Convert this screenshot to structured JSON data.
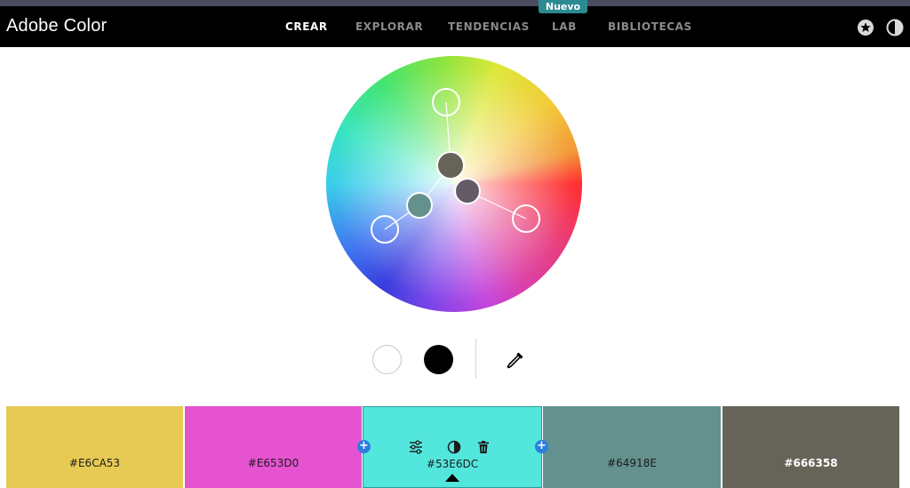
{
  "app": {
    "title": "Adobe Color"
  },
  "nav": {
    "items": [
      {
        "label": "CREAR",
        "active": true
      },
      {
        "label": "EXPLORAR",
        "active": false
      },
      {
        "label": "TENDENCIAS",
        "active": false
      },
      {
        "label": "LAB",
        "active": false
      },
      {
        "label": "BIBLIOTECAS",
        "active": false
      }
    ],
    "badge": "Nuevo"
  },
  "header_icons": [
    "star-icon",
    "contrast-icon"
  ],
  "wheel_handles": [
    {
      "name": "handle-yellow",
      "color": "#E6CA53"
    },
    {
      "name": "handle-magenta",
      "color": "#E653D0"
    },
    {
      "name": "handle-cyan",
      "color": "#53E6DC"
    },
    {
      "name": "handle-teal",
      "color": "#64918E"
    },
    {
      "name": "handle-base",
      "color": "#666358"
    }
  ],
  "controls": {
    "white_color": "#FFFFFF",
    "black_color": "#000000",
    "eyedropper": "eyedropper-icon"
  },
  "swatches": [
    {
      "hex": "#E6CA53",
      "color": "#E6CA53"
    },
    {
      "hex": "#E653D0",
      "color": "#E653D0"
    },
    {
      "hex": "#53E6DC",
      "color": "#53E6DC",
      "selected": true
    },
    {
      "hex": "#64918E",
      "color": "#64918E"
    },
    {
      "hex": "#666358",
      "color": "#666358"
    }
  ],
  "swatch_tools": [
    "adjust-icon",
    "contrast-icon",
    "trash-icon"
  ],
  "add_buttons": [
    "+",
    "+"
  ]
}
